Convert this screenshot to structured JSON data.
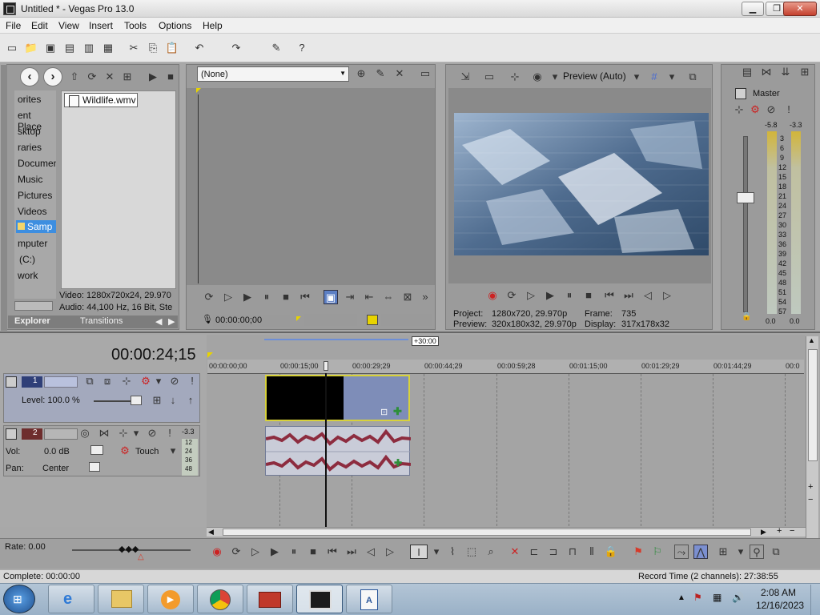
{
  "window": {
    "title": "Untitled * - Vegas Pro 13.0",
    "minimize_label": "▁",
    "maximize_label": "❐",
    "close_label": "✕"
  },
  "menu": [
    "File",
    "Edit",
    "View",
    "Insert",
    "Tools",
    "Options",
    "Help"
  ],
  "explorer": {
    "tree": [
      "orites",
      "ent Place",
      "sktop",
      "raries",
      "Documen",
      "Music",
      "Pictures",
      "Videos",
      "Samp",
      "mputer",
      "(C:)",
      "work"
    ],
    "file": "Wildlife.wmv",
    "video_info": "Video: 1280x720x24, 29.970",
    "audio_info": "Audio: 44,100 Hz, 16 Bit, Ste",
    "tabs": [
      "Explorer",
      "Transitions"
    ]
  },
  "trimmer": {
    "selection": "(None)",
    "timecode": "00:00:00;00"
  },
  "preview": {
    "quality": "Preview (Auto)",
    "project_label": "Project:",
    "project_value": "1280x720, 29.970p",
    "preview_label": "Preview:",
    "preview_value": "320x180x32, 29.970p",
    "frame_label": "Frame:",
    "frame_value": "735",
    "display_label": "Display:",
    "display_value": "317x178x32"
  },
  "master": {
    "title": "Master",
    "level_left": "-5.8",
    "level_right": "-3.3",
    "scale": [
      "3",
      "6",
      "9",
      "12",
      "15",
      "18",
      "21",
      "24",
      "27",
      "30",
      "33",
      "36",
      "39",
      "42",
      "45",
      "48",
      "51",
      "54",
      "57"
    ],
    "bottom_left": "0.0",
    "bottom_right": "0.0"
  },
  "timeline": {
    "timecode": "00:00:24;15",
    "offset_badge": "+30:00",
    "ruler": [
      "00:00:00;00",
      "00:00:15;00",
      "00:00:29;29",
      "00:00:44;29",
      "00:00:59;28",
      "00:01:15;00",
      "00:01:29;29",
      "00:01:44;29",
      "00:0"
    ]
  },
  "tracks": {
    "video": {
      "number": "1",
      "level": "Level: 100.0 %"
    },
    "audio": {
      "number": "2",
      "vol_label": "Vol:",
      "vol_value": "0.0 dB",
      "pan_label": "Pan:",
      "pan_value": "Center",
      "mode": "Touch",
      "meter_top": "-3.3",
      "meter_scale": [
        "12",
        "24",
        "36",
        "48"
      ]
    }
  },
  "transport": {
    "rate": "Rate: 0.00"
  },
  "status": {
    "left": "Complete: 00:00:00",
    "right": "Record Time (2 channels): 27:38:55"
  },
  "clock": {
    "time": "2:08 AM",
    "date": "12/16/2023"
  }
}
